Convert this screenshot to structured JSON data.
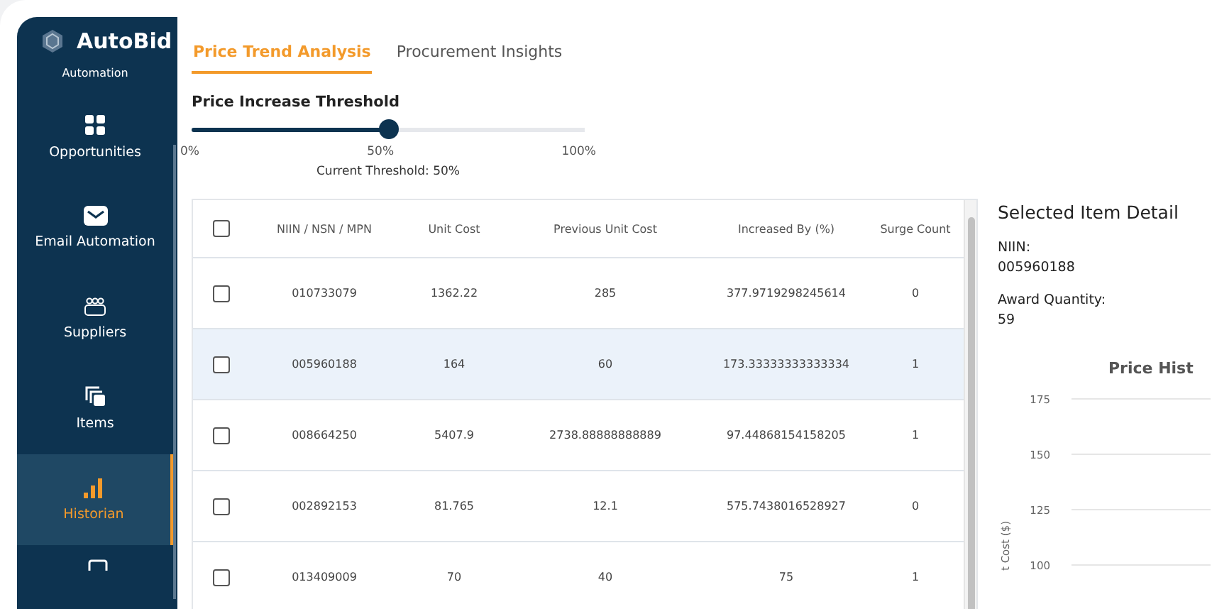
{
  "brand": {
    "name": "AutoBid"
  },
  "sidebar": {
    "items": [
      {
        "label": "Automation",
        "kind": "plain",
        "selected": false
      },
      {
        "label": "Opportunities",
        "kind": "icon",
        "selected": false
      },
      {
        "label": "Email Automation",
        "kind": "icon",
        "selected": false
      },
      {
        "label": "Suppliers",
        "kind": "icon",
        "selected": false
      },
      {
        "label": "Items",
        "kind": "icon",
        "selected": false
      },
      {
        "label": "Historian",
        "kind": "icon",
        "selected": true
      }
    ]
  },
  "tabs": [
    {
      "label": "Price Trend Analysis",
      "selected": true
    },
    {
      "label": "Procurement Insights",
      "selected": false
    }
  ],
  "threshold": {
    "title": "Price Increase Threshold",
    "level": 0.5,
    "marks": [
      "0%",
      "50%",
      "100%"
    ],
    "reading": "Current Threshold: 50%"
  },
  "table": {
    "all_checked": false,
    "columns": [
      "NIIN / NSN / MPN",
      "Unit Cost",
      "Previous Unit Cost",
      "Increased By (%)",
      "Surge Count"
    ],
    "rows": [
      {
        "selected": false,
        "checked": false,
        "cells": [
          "010733079",
          "1362.22",
          "285",
          "377.9719298245614",
          "0"
        ]
      },
      {
        "selected": true,
        "checked": false,
        "cells": [
          "005960188",
          "164",
          "60",
          "173.33333333333334",
          "1"
        ]
      },
      {
        "selected": false,
        "checked": false,
        "cells": [
          "008664250",
          "5407.9",
          "2738.88888888889",
          "97.44868154158205",
          "1"
        ]
      },
      {
        "selected": false,
        "checked": false,
        "cells": [
          "002892153",
          "81.765",
          "12.1",
          "575.7438016528927",
          "0"
        ]
      },
      {
        "selected": false,
        "checked": false,
        "cells": [
          "013409009",
          "70",
          "40",
          "75",
          "1"
        ]
      }
    ]
  },
  "details": {
    "title": "Selected Item Detail",
    "fields": [
      {
        "label": "NIIN:",
        "value": "005960188"
      },
      {
        "label": "Award Quantity:",
        "value": "59"
      }
    ],
    "price_history": {
      "title": "Price Hist",
      "ylabel": "t Cost ($)",
      "yticks": [
        "175",
        "150",
        "125",
        "100"
      ]
    }
  }
}
